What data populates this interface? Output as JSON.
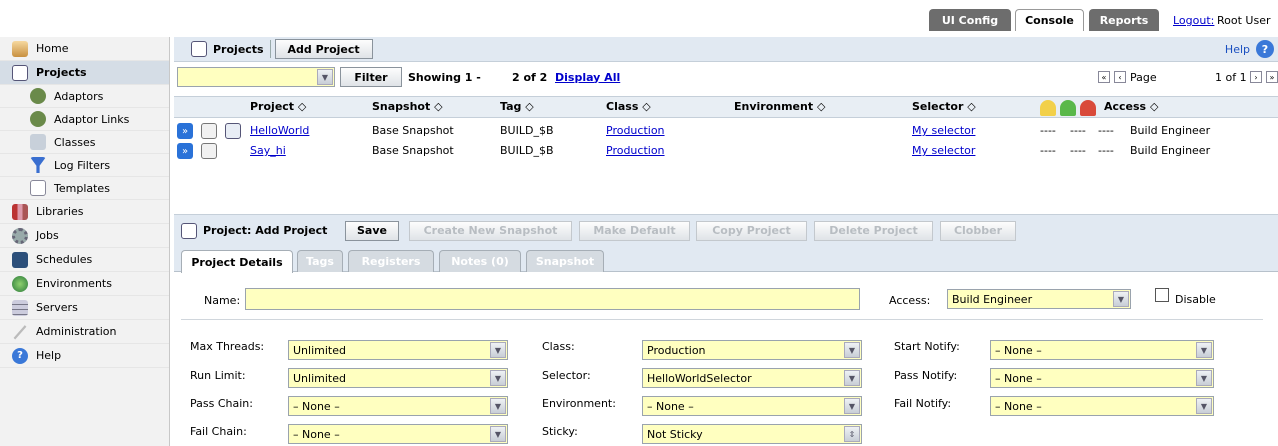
{
  "top": {
    "ui_config": "UI Config",
    "console": "Console",
    "reports": "Reports",
    "logout_link": "Logout:",
    "user": "Root User"
  },
  "sidebar": {
    "items": [
      {
        "label": "Home"
      },
      {
        "label": "Projects"
      },
      {
        "label": "Adaptors"
      },
      {
        "label": "Adaptor Links"
      },
      {
        "label": "Classes"
      },
      {
        "label": "Log Filters"
      },
      {
        "label": "Templates"
      },
      {
        "label": "Libraries"
      },
      {
        "label": "Jobs"
      },
      {
        "label": "Schedules"
      },
      {
        "label": "Environments"
      },
      {
        "label": "Servers"
      },
      {
        "label": "Administration"
      },
      {
        "label": "Help"
      }
    ]
  },
  "projects_header": {
    "title": "Projects",
    "add_button": "Add Project",
    "help": "Help"
  },
  "filter_bar": {
    "filter_button": "Filter",
    "showing": "Showing 1 -",
    "count": "2 of 2",
    "display_all": "Display All",
    "page_label": "Page",
    "page_value": "1 of 1"
  },
  "table": {
    "columns": [
      "Project",
      "Snapshot",
      "Tag",
      "Class",
      "Environment",
      "Selector",
      "Access"
    ],
    "rows": [
      {
        "project": "HelloWorld",
        "snapshot": "Base Snapshot",
        "tag": "BUILD_$B",
        "class": "Production",
        "environment": "",
        "selector": "My selector",
        "p1": "----",
        "p2": "----",
        "p3": "----",
        "access": "Build Engineer"
      },
      {
        "project": "Say_hi",
        "snapshot": "Base Snapshot",
        "tag": "BUILD_$B",
        "class": "Production",
        "environment": "",
        "selector": "My selector",
        "p1": "----",
        "p2": "----",
        "p3": "----",
        "access": "Build Engineer"
      }
    ]
  },
  "detail_header": {
    "title": "Project: Add Project",
    "save": "Save",
    "create_snapshot": "Create New Snapshot",
    "make_default": "Make Default",
    "copy_project": "Copy Project",
    "delete_project": "Delete Project",
    "clobber": "Clobber"
  },
  "tabs": [
    "Project Details",
    "Tags",
    "Registers",
    "Notes (0)",
    "Snapshot"
  ],
  "form": {
    "name_label": "Name:",
    "name_value": "",
    "access_label": "Access:",
    "access_value": "Build Engineer",
    "disable_label": "Disable",
    "max_threads_label": "Max Threads:",
    "max_threads": "Unlimited",
    "run_limit_label": "Run Limit:",
    "run_limit": "Unlimited",
    "pass_chain_label": "Pass Chain:",
    "pass_chain": "– None –",
    "fail_chain_label": "Fail Chain:",
    "fail_chain": "– None –",
    "class_label": "Class:",
    "class_value": "Production",
    "selector_label": "Selector:",
    "selector_value": "HelloWorldSelector",
    "environment_label": "Environment:",
    "environment_value": "– None –",
    "sticky_label": "Sticky:",
    "sticky_value": "Not Sticky",
    "start_notify_label": "Start Notify:",
    "start_notify": "– None –",
    "pass_notify_label": "Pass Notify:",
    "pass_notify": "– None –",
    "fail_notify_label": "Fail Notify:",
    "fail_notify": "– None –"
  },
  "colors": {
    "tab_dark": "#6b6b6b",
    "header_bg": "#e1e9f2",
    "input_bg": "#ffffc0",
    "link": "#0000cc"
  }
}
